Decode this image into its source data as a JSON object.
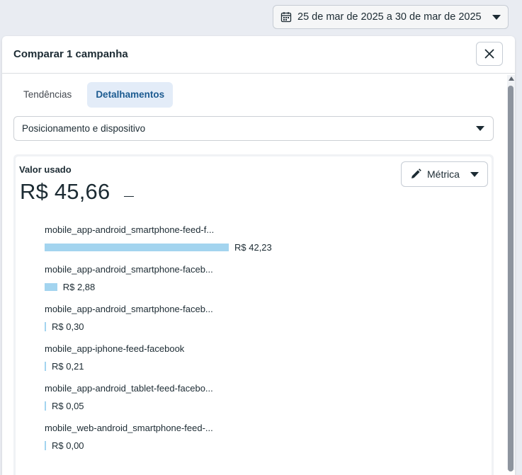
{
  "date_range": {
    "label": "25 de mar de 2025 a 30 de mar de 2025"
  },
  "panel": {
    "title": "Comparar 1 campanha",
    "tabs": [
      {
        "label": "Tendências",
        "active": false
      },
      {
        "label": "Detalhamentos",
        "active": true
      }
    ],
    "breakdown_select": {
      "value": "Posicionamento e dispositivo"
    }
  },
  "metric": {
    "label": "Valor usado",
    "value": "R$ 45,66",
    "button_label": "Métrica"
  },
  "rows": [
    {
      "label": "mobile_app-android_smartphone-feed-f...",
      "value_text": "R$ 42,23",
      "value": 42.23
    },
    {
      "label": "mobile_app-android_smartphone-faceb...",
      "value_text": "R$ 2,88",
      "value": 2.88
    },
    {
      "label": "mobile_app-android_smartphone-faceb...",
      "value_text": "R$ 0,30",
      "value": 0.3
    },
    {
      "label": "mobile_app-iphone-feed-facebook",
      "value_text": "R$ 0,21",
      "value": 0.21
    },
    {
      "label": "mobile_app-android_tablet-feed-facebo...",
      "value_text": "R$ 0,05",
      "value": 0.05
    },
    {
      "label": "mobile_web-android_smartphone-feed-...",
      "value_text": "R$ 0,00",
      "value": 0.0
    }
  ],
  "colors": {
    "bar": "#a3d4ef",
    "active_tab_bg": "#e3ecf8",
    "active_tab_text": "#1b5a90"
  }
}
